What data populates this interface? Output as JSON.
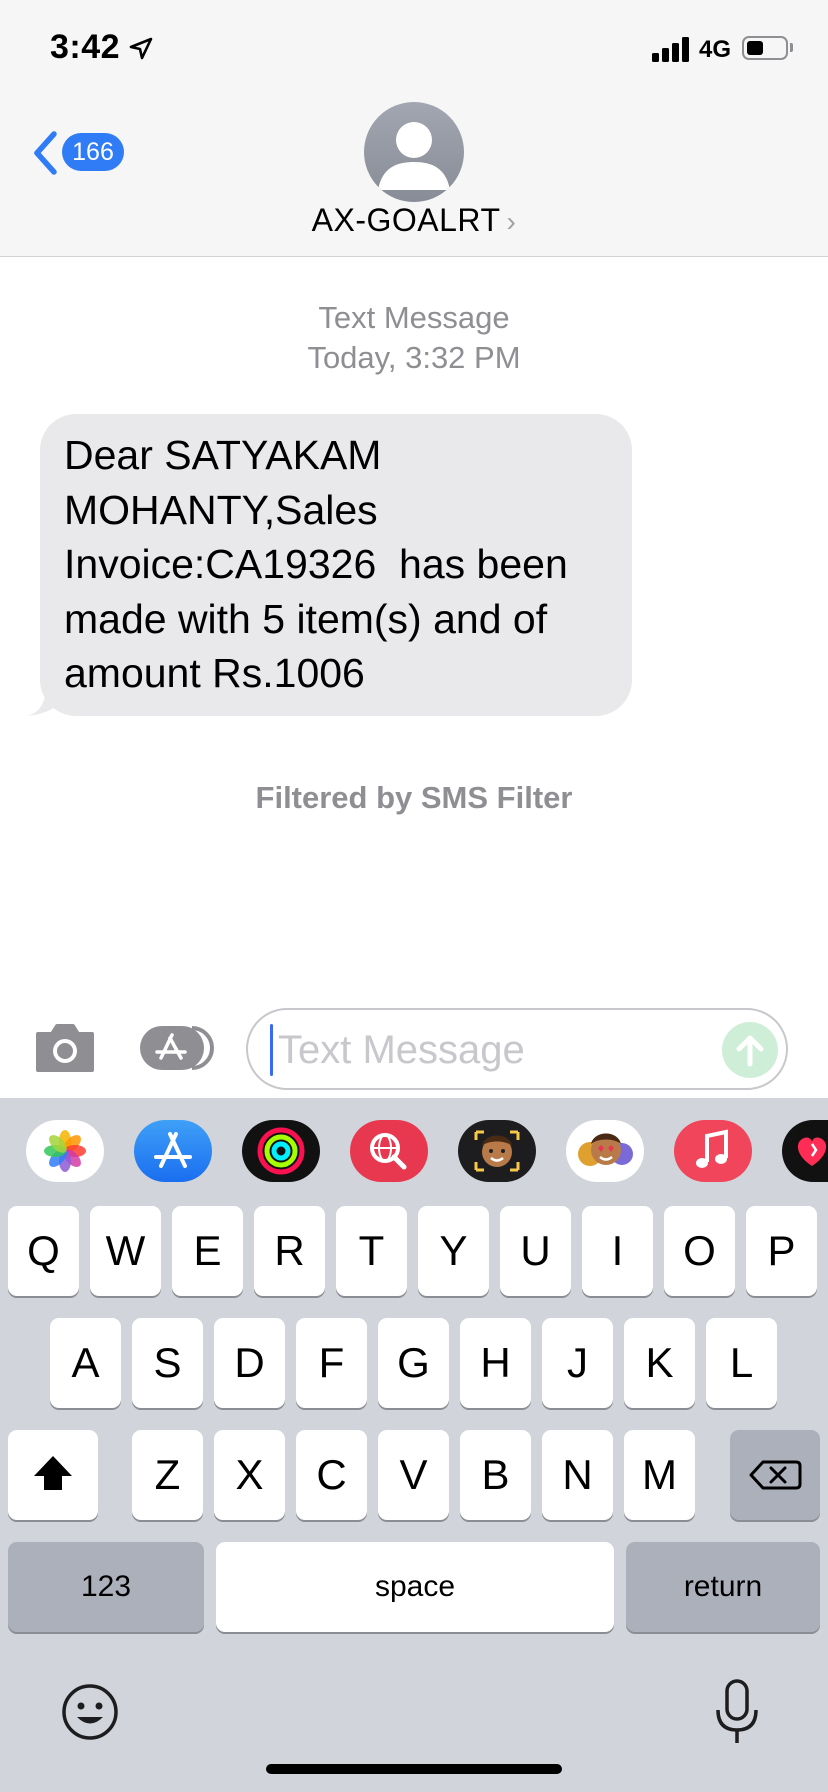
{
  "status_bar": {
    "time": "3:42",
    "network": "4G"
  },
  "header": {
    "back_count": "166",
    "contact_name": "AX-GOALRT",
    "chevron": "›"
  },
  "conversation": {
    "message_type": "Text Message",
    "timestamp": "Today, 3:32 PM",
    "message_text": "Dear SATYAKAM\nMOHANTY,Sales\nInvoice:CA19326  has been\nmade with 5 item(s) and of\namount Rs.1006",
    "filter_note": "Filtered by SMS Filter"
  },
  "input_bar": {
    "placeholder": "Text Message"
  },
  "app_strip": [
    {
      "icon": "photos-icon"
    },
    {
      "icon": "app-store-icon"
    },
    {
      "icon": "activity-icon"
    },
    {
      "icon": "web-search-icon"
    },
    {
      "icon": "memoji-icon"
    },
    {
      "icon": "memoji-stickers-icon"
    },
    {
      "icon": "music-icon"
    },
    {
      "icon": "digital-touch-icon"
    }
  ],
  "keyboard": {
    "row1": [
      "Q",
      "W",
      "E",
      "R",
      "T",
      "Y",
      "U",
      "I",
      "O",
      "P"
    ],
    "row2": [
      "A",
      "S",
      "D",
      "F",
      "G",
      "H",
      "J",
      "K",
      "L"
    ],
    "row3": [
      "Z",
      "X",
      "C",
      "V",
      "B",
      "N",
      "M"
    ],
    "numbers_label": "123",
    "space_label": "space",
    "return_label": "return"
  },
  "colors": {
    "accent_blue": "#2f7cf6",
    "bubble_gray": "#e9e9eb",
    "keyboard_bg": "#d1d4da"
  }
}
